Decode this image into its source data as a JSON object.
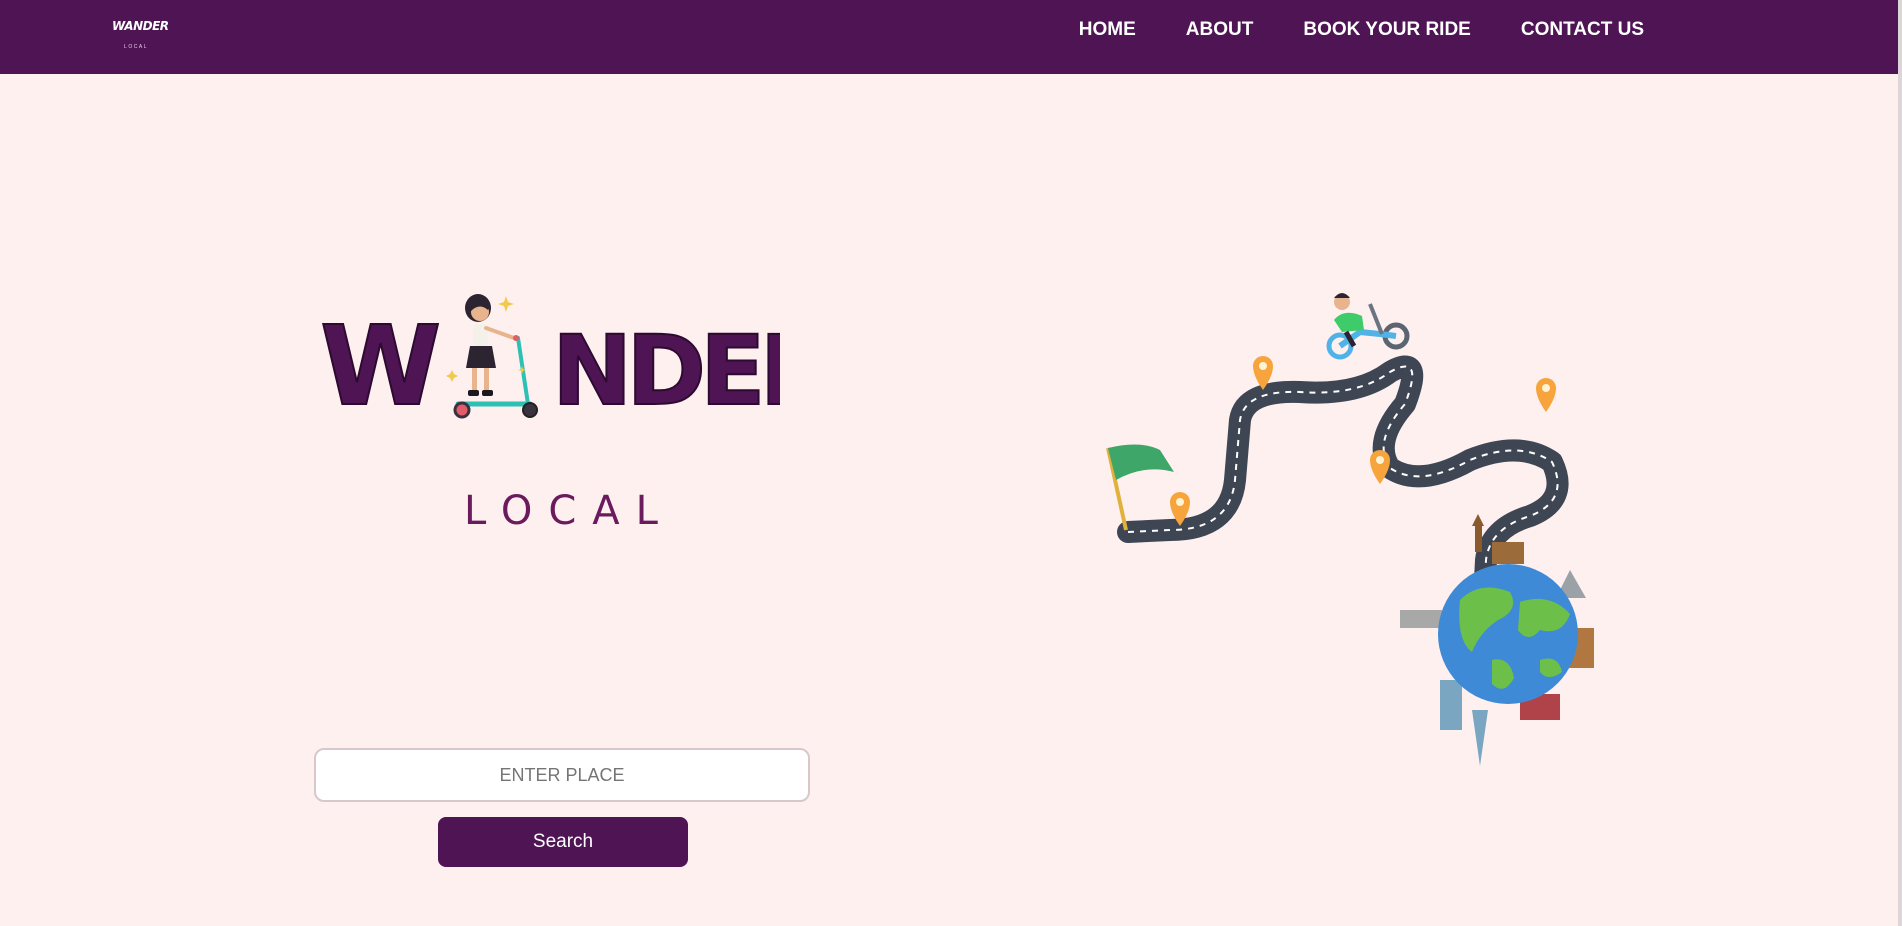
{
  "nav": {
    "logo_title": "WANDER",
    "logo_sub": "LOCAL",
    "links": [
      "HOME",
      "ABOUT",
      "BOOK YOUR RIDE",
      "CONTACT US"
    ]
  },
  "hero": {
    "brand_title": "W NDER",
    "brand_sub": "LOCAL"
  },
  "search": {
    "placeholder": "ENTER PLACE",
    "value": "",
    "button_label": "Search"
  },
  "colors": {
    "nav_bg": "#4e1454",
    "page_bg": "#fff0f0",
    "brand_purple": "#4e1454",
    "accent_plum": "#6a1a5d"
  },
  "icons": [
    "scooter-girl-icon",
    "scooter-rider-icon",
    "flag-icon",
    "location-pin-icon",
    "globe-icon",
    "road-icon"
  ]
}
